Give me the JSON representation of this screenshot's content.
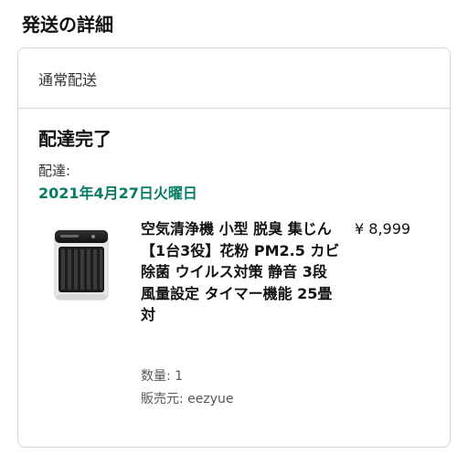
{
  "section": {
    "title": "発送の詳細"
  },
  "shipment": {
    "method": "通常配送",
    "status": "配達完了",
    "delivery_label": "配達:",
    "delivery_date": "2021年4月27日火曜日",
    "date_color": "#067d62"
  },
  "item": {
    "icon": "air-purifier-product-image",
    "title": "空気清浄機 小型 脱臭 集じん【1台3役】花粉 PM2.5 カビ 除菌 ウイルス対策 静音 3段 風量設定 タイマー機能 25畳対",
    "price": "¥ 8,999",
    "quantity": "数量: 1",
    "seller": "販売元: eezyue"
  }
}
